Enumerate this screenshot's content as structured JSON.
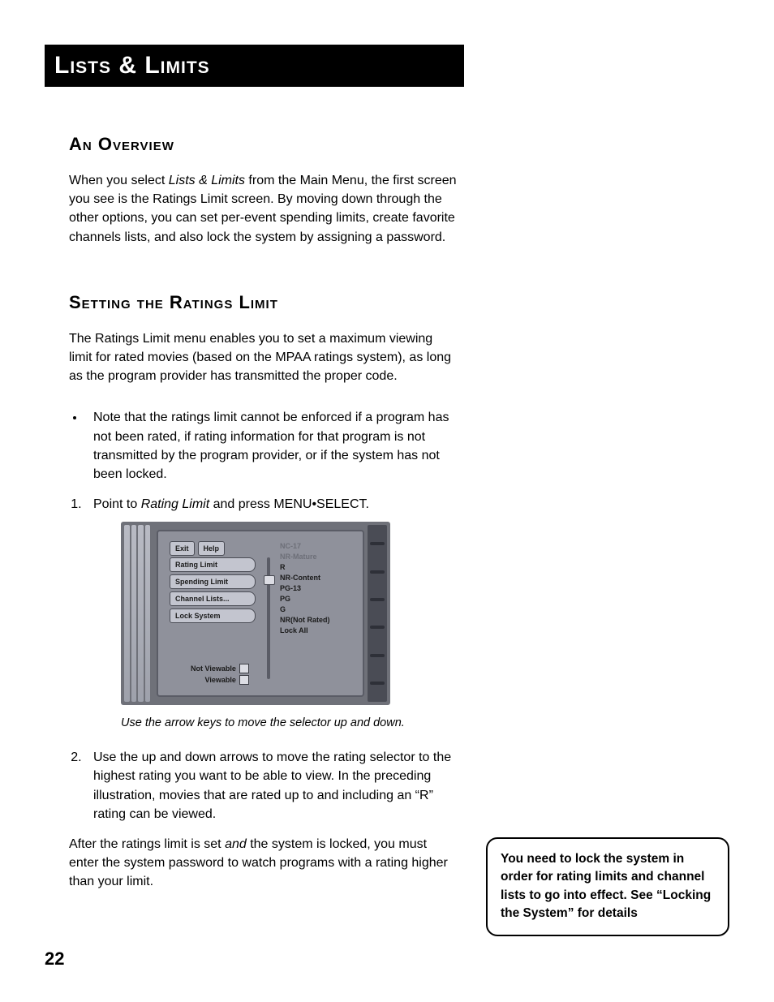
{
  "titleBar": "Lists & Limits",
  "overview": {
    "heading": "An Overview",
    "p_a": "When you select ",
    "p_em": "Lists & Limits",
    "p_b": " from the Main Menu, the first screen you see is the Ratings Limit screen. By moving down through the other options, you can set per-event spending limits, create favorite channels lists, and also lock the system by assigning a password."
  },
  "ratings": {
    "heading": "Setting the Ratings Limit",
    "intro": "The Ratings Limit menu enables you to set a maximum viewing limit for rated movies (based on the MPAA ratings system), as long as the program provider has transmitted the proper code.",
    "bullet": "Note that the ratings limit cannot be enforced if a program has not been rated, if rating information for that program is not transmitted by the program provider, or if the system has not been locked.",
    "step1_a": "Point to ",
    "step1_em": "Rating Limit",
    "step1_b": " and press MENU•SELECT.",
    "caption": "Use the arrow keys to move the selector up and down.",
    "step2": "Use the up and down arrows to move the rating selector to the highest rating you want to be able to view.  In the preceding illustration, movies that are rated up to and including an “R” rating can be viewed.",
    "after_a": "After the ratings limit is set ",
    "after_em": "and",
    "after_b": " the system is locked, you must enter the system password to watch programs with a rating higher than your limit."
  },
  "ui": {
    "exit": "Exit",
    "help": "Help",
    "menu": [
      "Rating Limit",
      "Spending Limit",
      "Channel Lists...",
      "Lock System"
    ],
    "ratings_dim": [
      "NC-17",
      "NR-Mature"
    ],
    "ratings_on": [
      "R",
      "NR-Content",
      "PG-13",
      "PG",
      "G",
      "NR(Not Rated)",
      "Lock All"
    ],
    "legend_not": "Not Viewable",
    "legend_yes": "Viewable"
  },
  "noteBox": "You need to lock the system in order for rating limits and channel lists to go into effect. See “Locking the System” for details",
  "pageNumber": "22"
}
